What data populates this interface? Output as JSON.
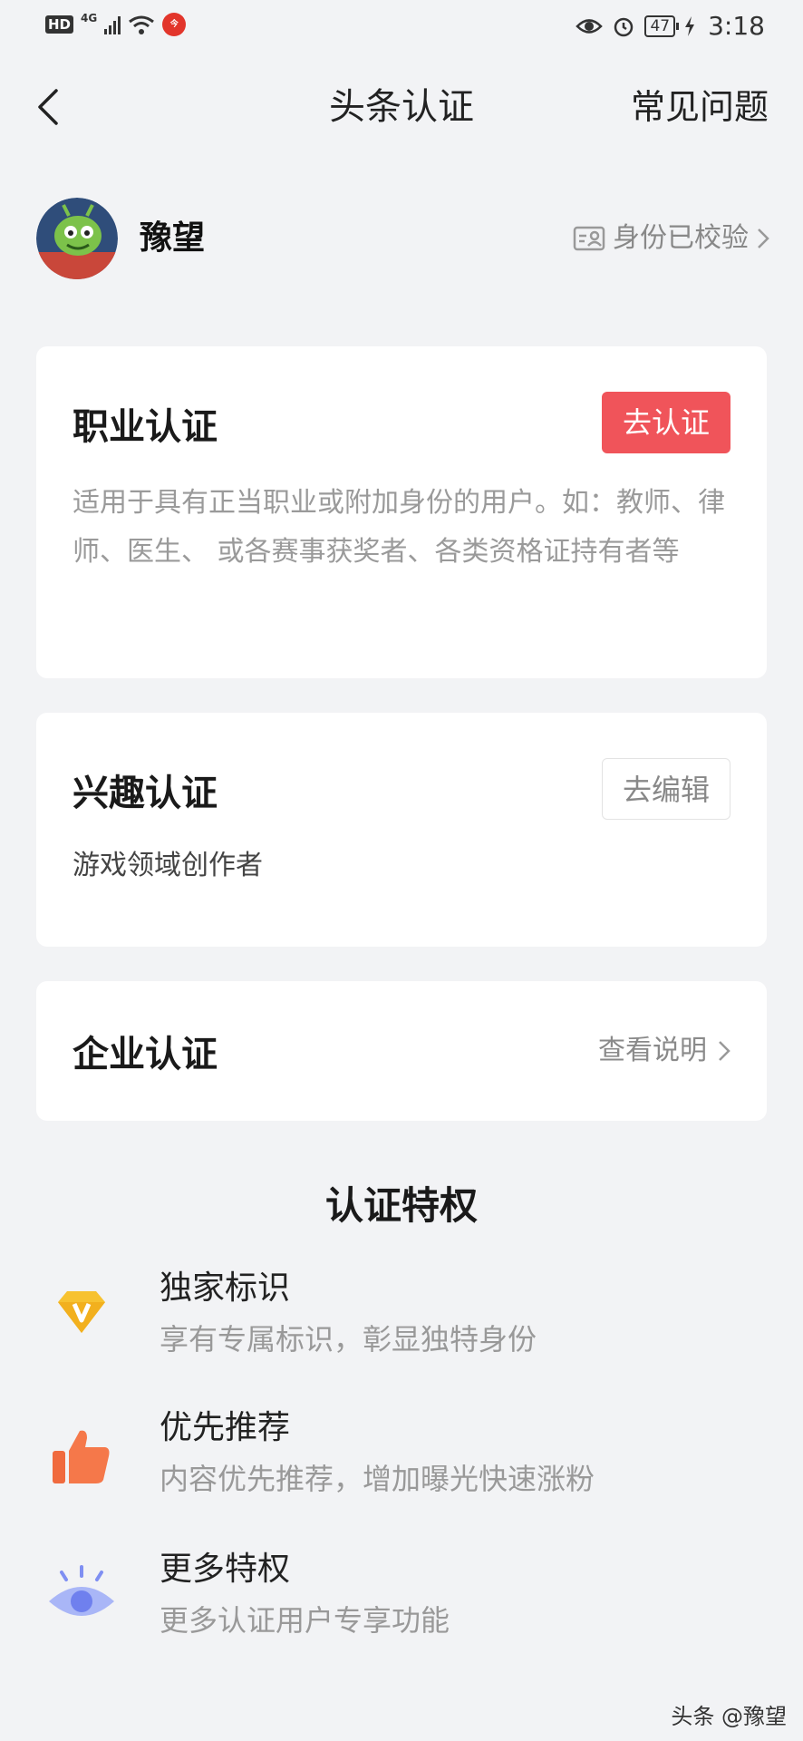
{
  "status_bar": {
    "hd": "HD",
    "network": "4G",
    "battery": "47",
    "time": "3:18"
  },
  "nav": {
    "title": "头条认证",
    "faq": "常见问题"
  },
  "profile": {
    "name": "豫望",
    "verify_text": "身份已校验"
  },
  "cards": {
    "professional": {
      "title": "职业认证",
      "button": "去认证",
      "desc": "适用于具有正当职业或附加身份的用户。如：教师、律师、医生、 或各赛事获奖者、各类资格证持有者等"
    },
    "interest": {
      "title": "兴趣认证",
      "button": "去编辑",
      "desc": "游戏领域创作者"
    },
    "enterprise": {
      "title": "企业认证",
      "link": "查看说明"
    }
  },
  "privileges": {
    "title": "认证特权",
    "items": [
      {
        "name": "独家标识",
        "desc": "享有专属标识，彰显独特身份",
        "icon": "diamond-v-icon"
      },
      {
        "name": "优先推荐",
        "desc": "内容优先推荐，增加曝光快速涨粉",
        "icon": "thumbs-up-icon"
      },
      {
        "name": "更多特权",
        "desc": "更多认证用户专享功能",
        "icon": "eye-icon"
      }
    ]
  },
  "watermark": "头条 @豫望",
  "colors": {
    "accent_red": "#f0545a",
    "background": "#f2f3f5"
  }
}
